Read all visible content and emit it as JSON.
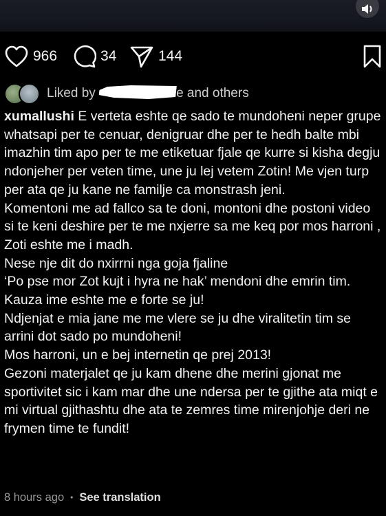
{
  "actions": {
    "likes_count": "966",
    "comments_count": "34",
    "shares_count": "144"
  },
  "liked_by": {
    "prefix": "Liked by",
    "suffix": "e and others"
  },
  "caption": {
    "username": "xumallushi",
    "lines": [
      "E verteta eshte qe sado te mundoheni neper grupe whatsapi per te cenuar, denigruar dhe per te hedh balte mbi imazhin tim apo per te me etiketuar fjale qe kurre si kisha degju ndonjeher per veten time, une ju lej vetem Zotin! Me vjen turp per ata qe ju kane ne familje ca monstrash jeni.",
      "Komentoni me ad fallco sa te doni, montoni dhe postoni video si te keni deshire per te me nxjerre sa me keq por mos harroni , Zoti eshte me i madh.",
      "Nese nje dit do nxirrni nga goja fjaline",
      "‘Po pse mor Zot kujt i hyra ne hak’ mendoni dhe emrin tim.",
      "Kauza ime eshte me e forte se ju!",
      "Ndjenjat e mia jane me me vlere se ju dhe viralitetin tim se arrini dot sado po mundoheni!",
      "Mos harroni, un e bej internetin qe prej 2013!",
      "Gezoni materjalet qe ju kam dhene dhe merini gjonat me sportivitet sic i kam mar dhe une ndersa per te gjithe ata miqt e mi virtual gjithashtu dhe ata te zemres time mirenjohje deri ne frymen time te fundit!"
    ]
  },
  "meta": {
    "time": "8 hours ago",
    "separator": "•",
    "see_translation": "See translation"
  }
}
